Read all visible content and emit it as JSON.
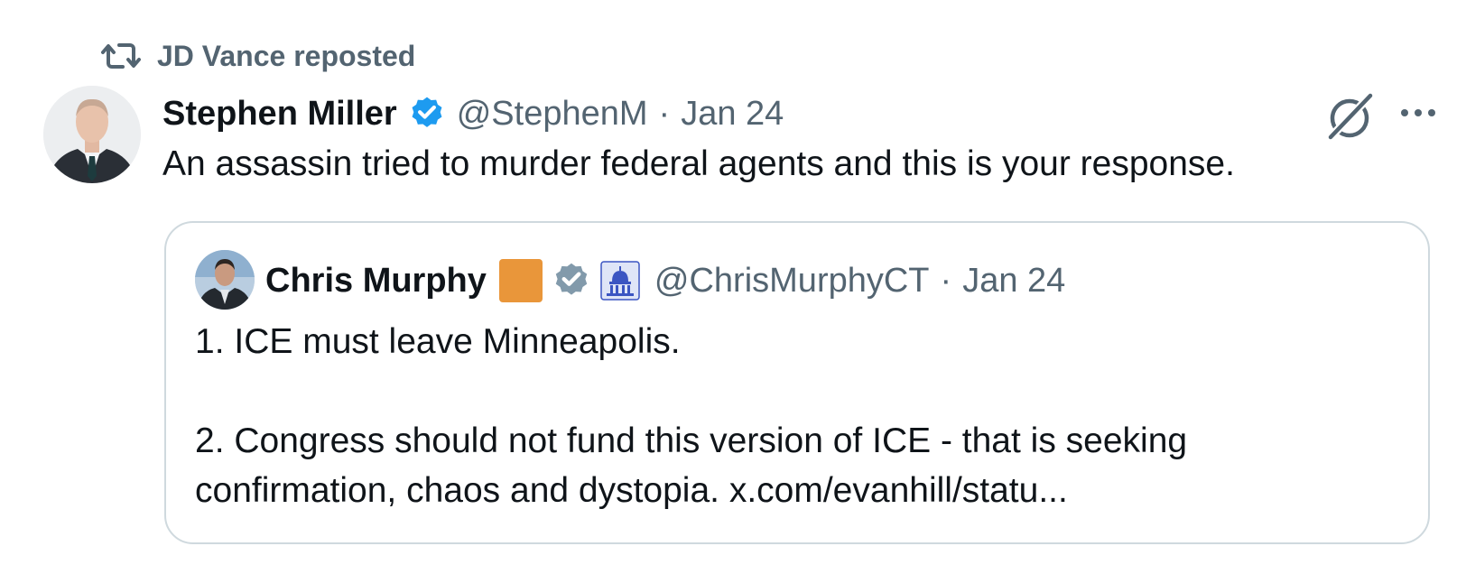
{
  "repost": {
    "label": "JD Vance reposted"
  },
  "post": {
    "author_name": "Stephen Miller",
    "handle": "@StephenM",
    "separator": "·",
    "date": "Jan 24",
    "text": "An assassin tried to murder federal agents and this is your response."
  },
  "quoted": {
    "author_name": "Chris Murphy",
    "handle": "@ChrisMurphyCT",
    "separator": "·",
    "date": "Jan 24",
    "line1": "1. ICE must leave Minneapolis.",
    "line2": "2. Congress should not fund this version of ICE - that is seeking",
    "line3": "confirmation, chaos and dystopia. x.com/evanhill/statu..."
  },
  "icons": {
    "repost": "repost-icon",
    "verified": "verified-badge-icon",
    "grok": "grok-icon",
    "more": "more-options-icon",
    "flag": "orange-square-flag",
    "gray_verified": "gray-verified-badge-icon",
    "capitol": "capitol-affiliate-icon"
  },
  "colors": {
    "text": "#0f1419",
    "secondary": "#536471",
    "verified_blue": "#1d9bf0",
    "verified_gray": "#829aab",
    "border": "#cfd9de",
    "orange": "#e9963a"
  }
}
